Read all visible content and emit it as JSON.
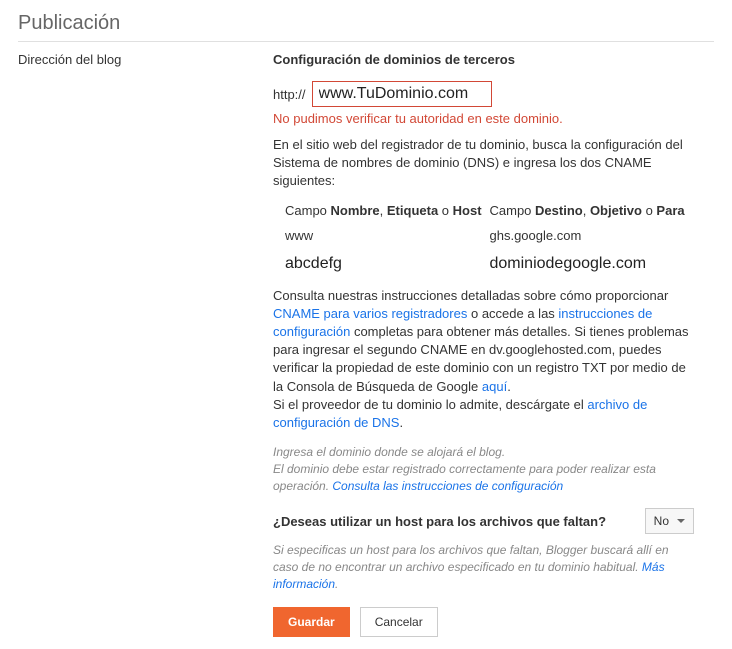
{
  "page_title": "Publicación",
  "left_label": "Dirección del blog",
  "section_heading": "Configuración de dominios de terceros",
  "protocol": "http://",
  "domain_value": "www.TuDominio.com",
  "error_msg": "No pudimos verificar tu autoridad en este dominio.",
  "dns_intro": "En el sitio web del registrador de tu dominio, busca la configuración del Sistema de nombres de dominio (DNS) e ingresa los dos CNAME siguientes:",
  "cname_header_left_prefix": "Campo ",
  "cname_header_left_b1": "Nombre",
  "cname_header_left_mid1": ", ",
  "cname_header_left_b2": "Etiqueta",
  "cname_header_left_mid2": " o ",
  "cname_header_left_b3": "Host",
  "cname_header_right_prefix": "Campo ",
  "cname_header_right_b1": "Destino",
  "cname_header_right_mid1": ", ",
  "cname_header_right_b2": "Objetivo",
  "cname_header_right_mid2": " o ",
  "cname_header_right_b3": "Para",
  "cname_row1_left": "www",
  "cname_row1_right": "ghs.google.com",
  "cname_row2_left": "abcdefg",
  "cname_row2_right": "dominiodegoogle.com",
  "instr_p1_a": "Consulta nuestras instrucciones detalladas sobre cómo proporcionar ",
  "instr_link1": "CNAME para varios registradores",
  "instr_p1_b": " o accede a las ",
  "instr_link2": "instrucciones de configuración",
  "instr_p1_c": " completas para obtener más detalles. Si tienes problemas para ingresar el segundo CNAME en dv.googlehosted.com, puedes verificar la propiedad de este dominio con un registro TXT por medio de la Consola de Búsqueda de Google ",
  "instr_link3": "aquí",
  "instr_p1_d": ".",
  "instr_p2_a": "Si el proveedor de tu dominio lo admite, descárgate el ",
  "instr_link4": "archivo de configuración de DNS",
  "instr_p2_b": ".",
  "help1_a": "Ingresa el dominio donde se alojará el blog.",
  "help1_b": "El dominio debe estar registrado correctamente para poder realizar esta operación. ",
  "help1_link": "Consulta las instrucciones de configuración",
  "question": "¿Deseas utilizar un host para los archivos que faltan?",
  "select_value": "No",
  "help2_a": "Si especificas un host para los archivos que faltan, Blogger buscará allí en caso de no encontrar un archivo especificado en tu dominio habitual. ",
  "help2_link": "Más información",
  "help2_b": ".",
  "btn_save": "Guardar",
  "btn_cancel": "Cancelar"
}
